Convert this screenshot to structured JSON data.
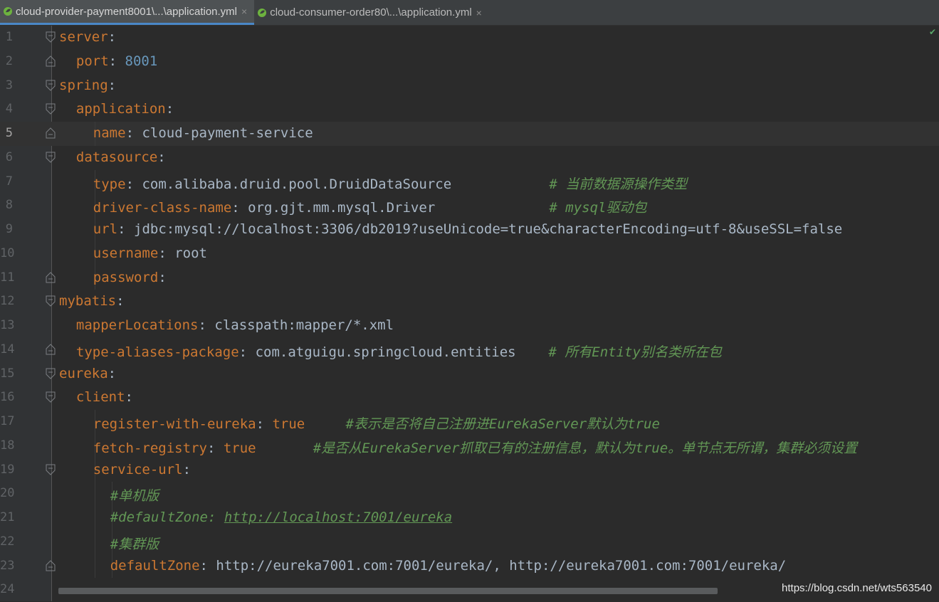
{
  "tabs": [
    {
      "label": "cloud-provider-payment8001\\...\\application.yml",
      "close": "×",
      "active": true
    },
    {
      "label": "cloud-consumer-order80\\...\\application.yml",
      "close": "×",
      "active": false
    }
  ],
  "lines": [
    {
      "num": "1",
      "indent": 0,
      "fold": "open",
      "parts": [
        [
          "k",
          "server"
        ],
        [
          "p",
          ":"
        ]
      ]
    },
    {
      "num": "2",
      "indent": 1,
      "fold": "end",
      "parts": [
        [
          "k",
          "port"
        ],
        [
          "p",
          ": "
        ],
        [
          "n",
          "8001"
        ]
      ]
    },
    {
      "num": "3",
      "indent": 0,
      "fold": "open",
      "parts": [
        [
          "k",
          "spring"
        ],
        [
          "p",
          ":"
        ]
      ]
    },
    {
      "num": "4",
      "indent": 1,
      "fold": "open",
      "parts": [
        [
          "k",
          "application"
        ],
        [
          "p",
          ":"
        ]
      ]
    },
    {
      "num": "5",
      "indent": 2,
      "fold": "end",
      "current": true,
      "parts": [
        [
          "k",
          "name"
        ],
        [
          "p",
          ": "
        ],
        [
          "v",
          "cloud-payment-service"
        ]
      ]
    },
    {
      "num": "6",
      "indent": 1,
      "fold": "open",
      "parts": [
        [
          "k",
          "datasource"
        ],
        [
          "p",
          ":"
        ]
      ]
    },
    {
      "num": "7",
      "indent": 2,
      "fold": "",
      "parts": [
        [
          "k",
          "type"
        ],
        [
          "p",
          ": "
        ],
        [
          "v",
          "com.alibaba.druid.pool.DruidDataSource            "
        ],
        [
          "c",
          "# 当前数据源操作类型"
        ]
      ]
    },
    {
      "num": "8",
      "indent": 2,
      "fold": "",
      "parts": [
        [
          "k",
          "driver-class-name"
        ],
        [
          "p",
          ": "
        ],
        [
          "v",
          "org.gjt.mm.mysql.Driver              "
        ],
        [
          "c",
          "# mysql驱动包"
        ]
      ]
    },
    {
      "num": "9",
      "indent": 2,
      "fold": "",
      "parts": [
        [
          "k",
          "url"
        ],
        [
          "p",
          ": "
        ],
        [
          "v",
          "jdbc:mysql://localhost:3306/db2019?useUnicode=true&characterEncoding=utf-8&useSSL=false"
        ]
      ]
    },
    {
      "num": "10",
      "indent": 2,
      "fold": "",
      "parts": [
        [
          "k",
          "username"
        ],
        [
          "p",
          ": "
        ],
        [
          "v",
          "root"
        ]
      ]
    },
    {
      "num": "11",
      "indent": 2,
      "fold": "end",
      "parts": [
        [
          "k",
          "password"
        ],
        [
          "p",
          ":"
        ]
      ]
    },
    {
      "num": "12",
      "indent": 0,
      "fold": "open",
      "parts": [
        [
          "k",
          "mybatis"
        ],
        [
          "p",
          ":"
        ]
      ]
    },
    {
      "num": "13",
      "indent": 1,
      "fold": "",
      "parts": [
        [
          "k",
          "mapperLocations"
        ],
        [
          "p",
          ": "
        ],
        [
          "v",
          "classpath:mapper/*.xml"
        ]
      ]
    },
    {
      "num": "14",
      "indent": 1,
      "fold": "end",
      "parts": [
        [
          "k",
          "type-aliases-package"
        ],
        [
          "p",
          ": "
        ],
        [
          "v",
          "com.atguigu.springcloud.entities    "
        ],
        [
          "c",
          "# 所有Entity别名类所在包"
        ]
      ]
    },
    {
      "num": "15",
      "indent": 0,
      "fold": "open",
      "parts": [
        [
          "k",
          "eureka"
        ],
        [
          "p",
          ":"
        ]
      ]
    },
    {
      "num": "16",
      "indent": 1,
      "fold": "open",
      "parts": [
        [
          "k",
          "client"
        ],
        [
          "p",
          ":"
        ]
      ]
    },
    {
      "num": "17",
      "indent": 2,
      "fold": "",
      "parts": [
        [
          "k",
          "register-with-eureka"
        ],
        [
          "p",
          ": "
        ],
        [
          "k",
          "true"
        ],
        [
          "v",
          "     "
        ],
        [
          "c",
          "#表示是否将自己注册进EurekaServer默认为true"
        ]
      ]
    },
    {
      "num": "18",
      "indent": 2,
      "fold": "",
      "parts": [
        [
          "k",
          "fetch-registry"
        ],
        [
          "p",
          ": "
        ],
        [
          "k",
          "true"
        ],
        [
          "v",
          "       "
        ],
        [
          "c",
          "#是否从EurekaServer抓取已有的注册信息，默认为true。单节点无所谓，集群必须设置"
        ]
      ]
    },
    {
      "num": "19",
      "indent": 2,
      "fold": "open",
      "parts": [
        [
          "k",
          "service-url"
        ],
        [
          "p",
          ":"
        ]
      ]
    },
    {
      "num": "20",
      "indent": 3,
      "fold": "",
      "parts": [
        [
          "c",
          "#单机版"
        ]
      ]
    },
    {
      "num": "21",
      "indent": 3,
      "fold": "",
      "parts": [
        [
          "c",
          "#defaultZone: "
        ],
        [
          "u",
          "http://localhost:7001/eureka"
        ]
      ]
    },
    {
      "num": "22",
      "indent": 3,
      "fold": "",
      "parts": [
        [
          "c",
          "#集群版"
        ]
      ]
    },
    {
      "num": "23",
      "indent": 3,
      "fold": "end",
      "parts": [
        [
          "k",
          "defaultZone"
        ],
        [
          "p",
          ": "
        ],
        [
          "v",
          "http://eureka7001.com:7001/eureka/, http://eureka7001.com:7001/eureka/"
        ]
      ]
    },
    {
      "num": "24",
      "indent": 0,
      "fold": "",
      "parts": []
    }
  ],
  "status_check_icon": "check-icon",
  "watermark": "https://blog.csdn.net/wts563540",
  "colors": {
    "keyword": "#cc7832",
    "number": "#6897bb",
    "comment": "#629755",
    "text": "#a9b7c6",
    "background": "#2b2b2b"
  }
}
